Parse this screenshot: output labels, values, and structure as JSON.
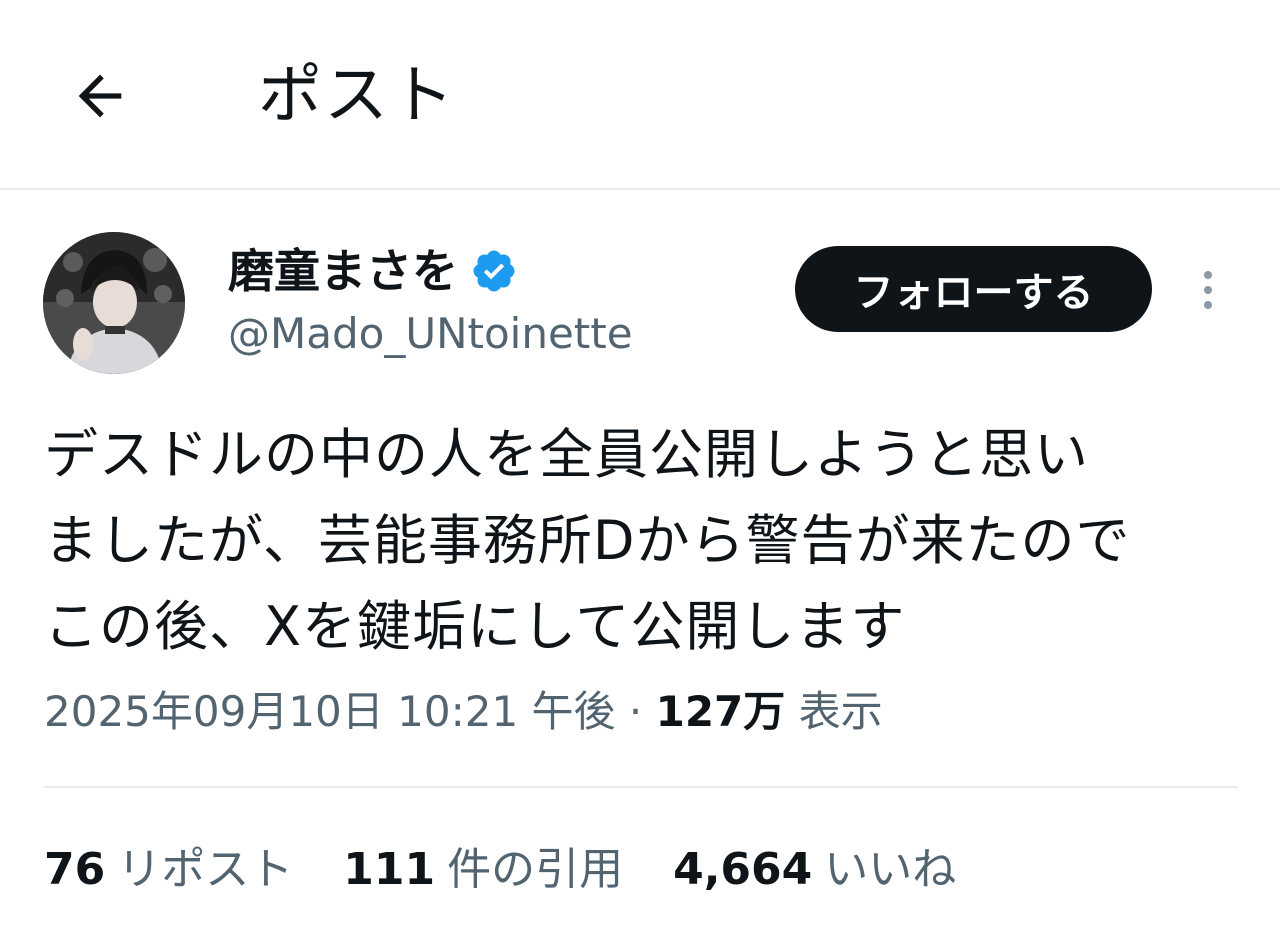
{
  "header": {
    "title": "ポスト",
    "back_icon": "arrow-left-icon"
  },
  "author": {
    "display_name": "磨童まさを",
    "handle": "@Mado_UNtoinette",
    "verified_icon": "verified-badge-icon",
    "verified_color": "#1d9bf0"
  },
  "follow_button": {
    "label": "フォローする"
  },
  "more_icon": "more-vertical-icon",
  "post": {
    "lines": [
      "デスドルの中の人を全員公開しようと思い",
      "ましたが、芸能事務所Dから警告が来たので",
      "この後、Xを鍵垢にして公開します"
    ]
  },
  "meta": {
    "datetime": "2025年09月10日 10:21 午後",
    "separator": "·",
    "views_count": "127万",
    "views_label": "表示"
  },
  "stats": {
    "reposts": {
      "count": "76",
      "label": "リポスト"
    },
    "quotes": {
      "count": "111",
      "label": "件の引用"
    },
    "likes": {
      "count": "4,664",
      "label": "いいね"
    }
  },
  "colors": {
    "text_primary": "#0f1419",
    "text_secondary": "#536471",
    "divider": "#e7e9ea",
    "button_bg": "#0f1419",
    "button_text": "#ffffff"
  }
}
